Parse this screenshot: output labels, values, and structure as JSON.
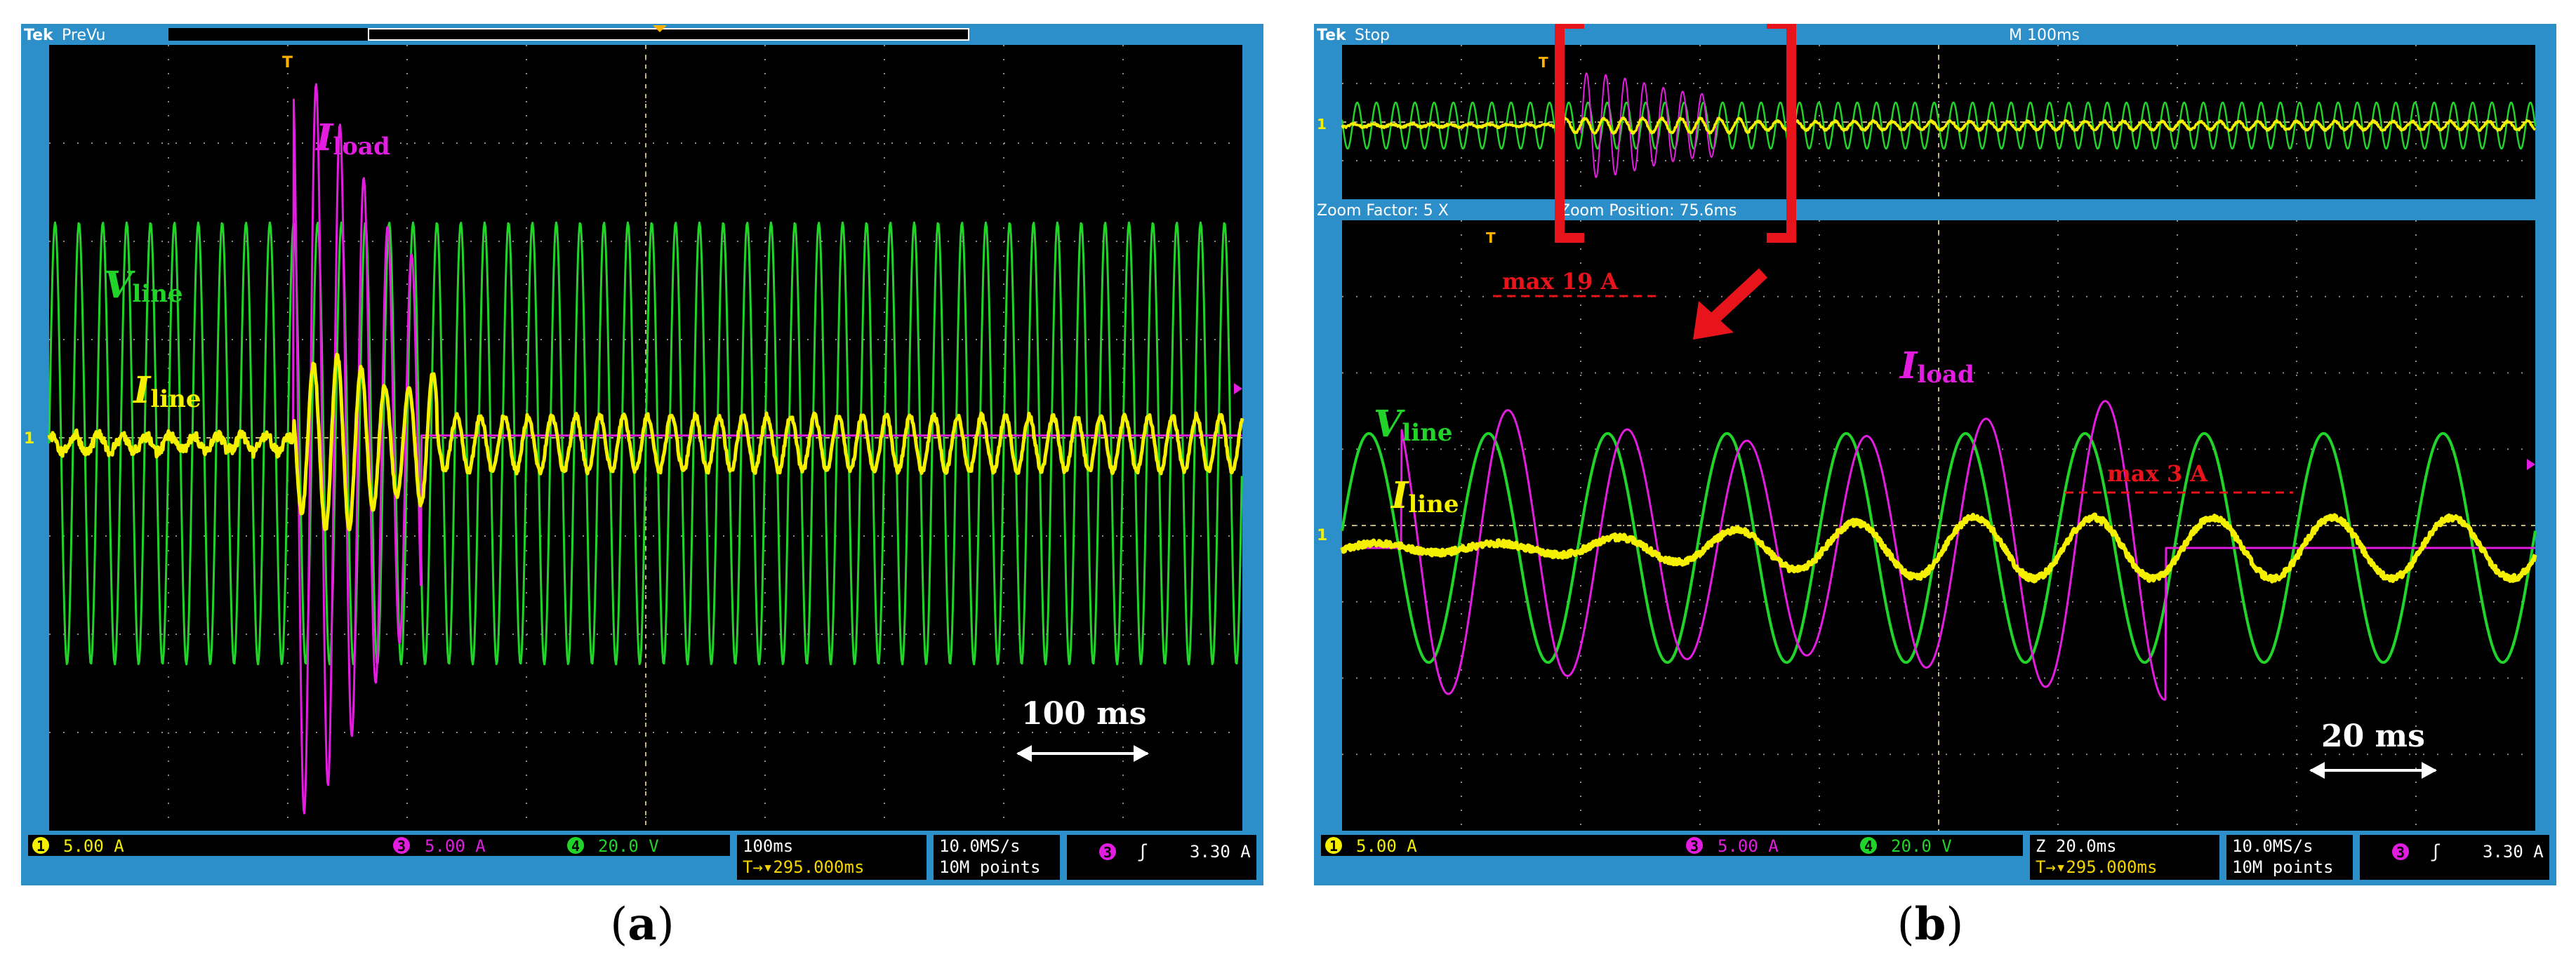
{
  "colors": {
    "ch1_yellow": "#f5f000",
    "ch3_magenta": "#e21ddf",
    "ch4_green": "#22d32a",
    "frame_blue": "#2d8fc9",
    "grid_dot": "#8a8a8a",
    "annotation_red": "#e8141c",
    "label_white": "#ffffff"
  },
  "panel_a": {
    "caption_open": "(",
    "caption_letter": "a",
    "caption_close": ")",
    "tek": "Tek",
    "mode": "PreVu",
    "trigger_marker": "T",
    "ground_marker": "1",
    "labels": {
      "iload_main": "I",
      "iload_sub": "load",
      "vline_main": "V",
      "vline_sub": "line",
      "iline_main": "I",
      "iline_sub": "line",
      "timescale": "100 ms"
    },
    "status": {
      "ch1_num": "1",
      "ch1_val": "5.00 A",
      "ch3_num": "3",
      "ch3_val": "5.00 A",
      "ch4_num": "4",
      "ch4_val": "20.0 V",
      "hscale": "100ms",
      "hpos": "T→▾295.000ms",
      "rate": "10.0MS/s",
      "points": "10M points",
      "trig_num": "3",
      "trig_slope": "ʃ",
      "trig_val": "3.30 A"
    }
  },
  "panel_b": {
    "caption_open": "(",
    "caption_letter": "b",
    "caption_close": ")",
    "tek": "Tek",
    "mode": "Stop",
    "record_scale": "M 100ms",
    "zoom_factor": "Zoom Factor: 5 X",
    "zoom_position": "Zoom Position: 75.6ms",
    "trigger_marker": "T",
    "ground_marker": "1",
    "labels": {
      "max_iload": "max 19 A",
      "max_iline": "max 3 A",
      "iload_main": "I",
      "iload_sub": "load",
      "vline_main": "V",
      "vline_sub": "line",
      "iline_main": "I",
      "iline_sub": "line",
      "timescale": "20 ms"
    },
    "status": {
      "ch1_num": "1",
      "ch1_val": "5.00 A",
      "ch3_num": "3",
      "ch3_val": "5.00 A",
      "ch4_num": "4",
      "ch4_val": "20.0 V",
      "hscale": "Z 20.0ms",
      "hpos": "T→▾295.000ms",
      "rate": "10.0MS/s",
      "points": "10M points",
      "trig_num": "3",
      "trig_slope": "ʃ",
      "trig_val": "3.30 A"
    }
  },
  "chart_data": [
    {
      "type": "line",
      "panel": "a",
      "x_unit": "ms",
      "divisions": {
        "x": 10,
        "y": 8
      },
      "scales": {
        "I_line_A_per_div": 5.0,
        "I_load_A_per_div": 5.0,
        "V_line_V_per_div": 20.0,
        "time_ms_per_div": 100
      },
      "series": [
        {
          "name": "Vline",
          "channel": 4,
          "amplitude_div": 2.25,
          "frequency_hz": 50,
          "time_ms": [
            0,
            1000
          ]
        },
        {
          "name": "Iline",
          "channel": 1,
          "baseline_peak_div": 0.1,
          "inrush_peak_div": 0.9,
          "steady_peak_div": 0.28,
          "inrush_start_ms": 205,
          "inrush_end_ms": 325,
          "steady_end_ms": 1000
        },
        {
          "name": "Iload",
          "channel": 3,
          "peak_div": 3.8,
          "active_ms": [
            205,
            312
          ],
          "tail_to_ms": 1000
        }
      ]
    },
    {
      "type": "line",
      "panel": "b",
      "x_unit": "ms",
      "divisions": {
        "x": 10,
        "y": 8
      },
      "scales": {
        "I_line_A_per_div": 5.0,
        "I_load_A_per_div": 5.0,
        "V_line_V_per_div": 20.0,
        "time_ms_per_div": 20
      },
      "series": [
        {
          "name": "Vline",
          "channel": 4,
          "amplitude_div": 1.5,
          "frequency_hz": 50,
          "time_ms": [
            0,
            200
          ]
        },
        {
          "name": "Iload",
          "channel": 3,
          "peak_A": 19,
          "peak_div": 2.0,
          "active_ms": [
            10,
            138
          ]
        },
        {
          "name": "Iline",
          "channel": 1,
          "peak_A": 3,
          "steady_peak_div": 0.4
        }
      ],
      "annotations": [
        "max 19 A",
        "max 3 A"
      ]
    }
  ]
}
